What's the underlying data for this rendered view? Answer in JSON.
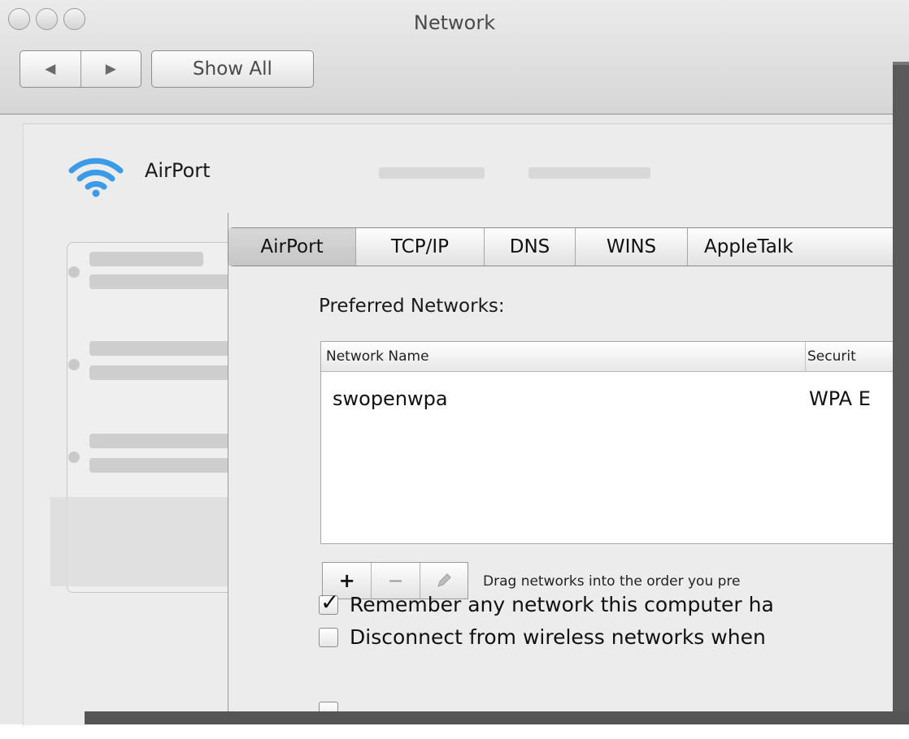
{
  "window": {
    "title": "Network",
    "back_label": "◀",
    "forward_label": "▶",
    "show_all_label": "Show All"
  },
  "service": {
    "name": "AirPort",
    "icon": "wifi-icon"
  },
  "tabs": [
    {
      "label": "AirPort",
      "selected": true
    },
    {
      "label": "TCP/IP",
      "selected": false
    },
    {
      "label": "DNS",
      "selected": false
    },
    {
      "label": "WINS",
      "selected": false
    },
    {
      "label": "AppleTalk",
      "selected": false
    }
  ],
  "preferred_networks": {
    "label": "Preferred Networks:",
    "columns": [
      "Network Name",
      "Securit"
    ],
    "rows": [
      {
        "name": "swopenwpa",
        "security": "WPA E"
      }
    ]
  },
  "list_controls": {
    "add_label": "+",
    "remove_label": "−",
    "edit_icon": "pencil-icon",
    "hint": "Drag networks into the order you pre"
  },
  "options": [
    {
      "label": "Remember any network this computer ha",
      "checked": true
    },
    {
      "label": "Disconnect from wireless networks when",
      "checked": false
    }
  ],
  "colors": {
    "wifi_blue": "#3b9be8",
    "window_bg": "#ececec"
  }
}
